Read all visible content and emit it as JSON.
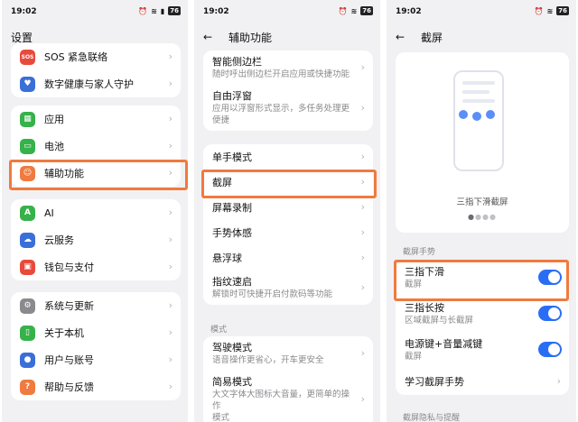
{
  "status": {
    "time": "19:02",
    "battery": "76"
  },
  "panel1": {
    "title": "设置",
    "card1": [
      {
        "label": "SOS 紧急联络",
        "icon": "sos-icon",
        "icon_text": "SOS",
        "color": "#e84a3c"
      },
      {
        "label": "数字健康与家人守护",
        "icon": "heart-icon",
        "icon_text": "♥",
        "color": "#3a6fd8"
      }
    ],
    "card2": [
      {
        "label": "应用",
        "icon": "apps-icon",
        "icon_text": "▦",
        "color": "#36b24a"
      },
      {
        "label": "电池",
        "icon": "battery-icon",
        "icon_text": "▭",
        "color": "#36b24a"
      },
      {
        "label": "辅助功能",
        "icon": "accessibility-icon",
        "icon_text": "☺",
        "color": "#f07a3f"
      }
    ],
    "card3": [
      {
        "label": "AI",
        "icon": "ai-icon",
        "icon_text": "A",
        "color": "#36b24a"
      },
      {
        "label": "云服务",
        "icon": "cloud-icon",
        "icon_text": "☁",
        "color": "#3a6fd8"
      },
      {
        "label": "钱包与支付",
        "icon": "wallet-icon",
        "icon_text": "▣",
        "color": "#e84a3c"
      }
    ],
    "card4": [
      {
        "label": "系统与更新",
        "icon": "gear-icon",
        "icon_text": "⚙",
        "color": "#8a8a8e"
      },
      {
        "label": "关于本机",
        "icon": "phone-icon",
        "icon_text": "▯",
        "color": "#36b24a"
      },
      {
        "label": "用户与账号",
        "icon": "user-icon",
        "icon_text": "●",
        "color": "#3a6fd8"
      },
      {
        "label": "帮助与反馈",
        "icon": "help-icon",
        "icon_text": "?",
        "color": "#f07a3f"
      }
    ]
  },
  "panel2": {
    "title": "辅助功能",
    "card1": [
      {
        "title": "智能侧边栏",
        "sub": "随时呼出侧边栏开启应用或快捷功能"
      },
      {
        "title": "自由浮窗",
        "sub1": "应用以浮窗形式显示，多任务处理更",
        "sub2": "便捷"
      }
    ],
    "card2": [
      "单手模式",
      "截屏",
      "屏幕录制",
      "手势体感",
      "悬浮球"
    ],
    "fingerprint": {
      "title": "指纹速启",
      "sub": "解锁时可快捷开启付款码等功能"
    },
    "section_mode": "模式",
    "drive": {
      "title": "驾驶模式",
      "sub": "语音操作更省心，开车更安全"
    },
    "simple": {
      "title": "简易模式",
      "sub1": "大文字体大图标大音量，更简单的操作",
      "sub2": "模式"
    }
  },
  "panel3": {
    "title": "截屏",
    "preview_caption": "三指下滑截屏",
    "section_gesture": "截屏手势",
    "items": [
      {
        "title": "三指下滑",
        "sub": "截屏",
        "toggle": "on"
      },
      {
        "title": "三指长按",
        "sub": "区域截屏与长截屏",
        "toggle": "on"
      },
      {
        "title": "电源键+音量减键",
        "sub": "截屏",
        "toggle": "on"
      }
    ],
    "learn": "学习截屏手势",
    "section_privacy": "截屏隐私与提醒",
    "accent": "#2a6df5"
  },
  "highlight_color": "#f07a3f"
}
